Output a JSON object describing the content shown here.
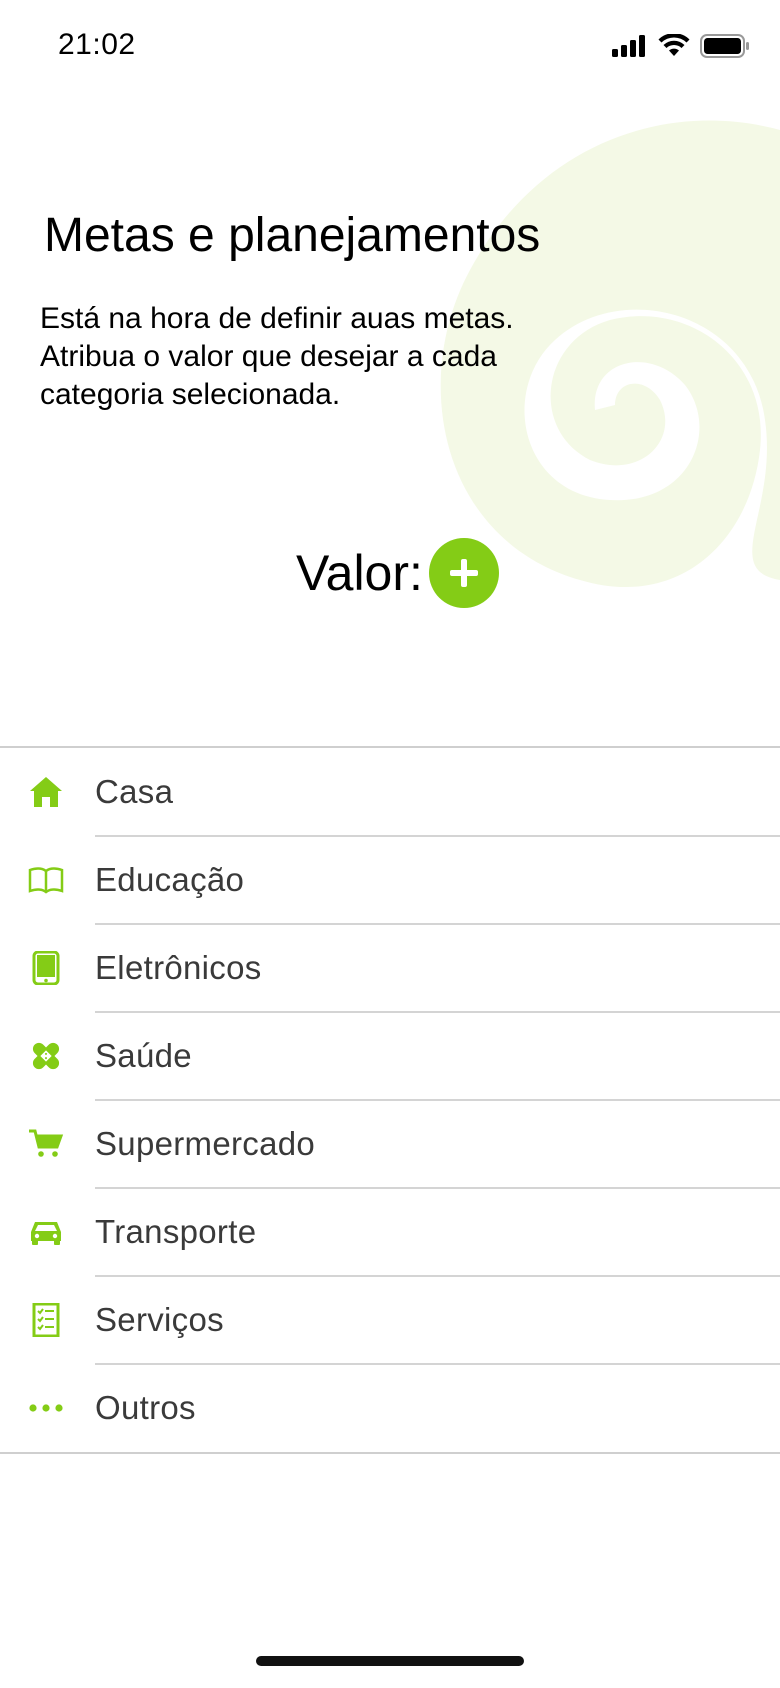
{
  "status_bar": {
    "time": "21:02",
    "icons": [
      "signal-icon",
      "wifi-icon",
      "battery-icon"
    ]
  },
  "header": {
    "title": "Metas e planejamentos",
    "description": "Está na hora de definir auas metas.\nAtribua o valor que desejar a cada\ncategoria selecionada."
  },
  "valor": {
    "label": "Valor:",
    "add_icon": "plus-icon"
  },
  "categories": [
    {
      "label": "Casa",
      "icon": "house-icon"
    },
    {
      "label": "Educação",
      "icon": "book-icon"
    },
    {
      "label": "Eletrônicos",
      "icon": "tablet-icon"
    },
    {
      "label": "Saúde",
      "icon": "bandage-icon"
    },
    {
      "label": "Supermercado",
      "icon": "cart-icon"
    },
    {
      "label": "Transporte",
      "icon": "car-icon"
    },
    {
      "label": "Serviços",
      "icon": "checklist-icon"
    },
    {
      "label": "Outros",
      "icon": "more-dots-icon"
    }
  ],
  "colors": {
    "accent": "#84cc16",
    "swirl": "#f4f9e6",
    "separator": "#d4d4d4"
  }
}
